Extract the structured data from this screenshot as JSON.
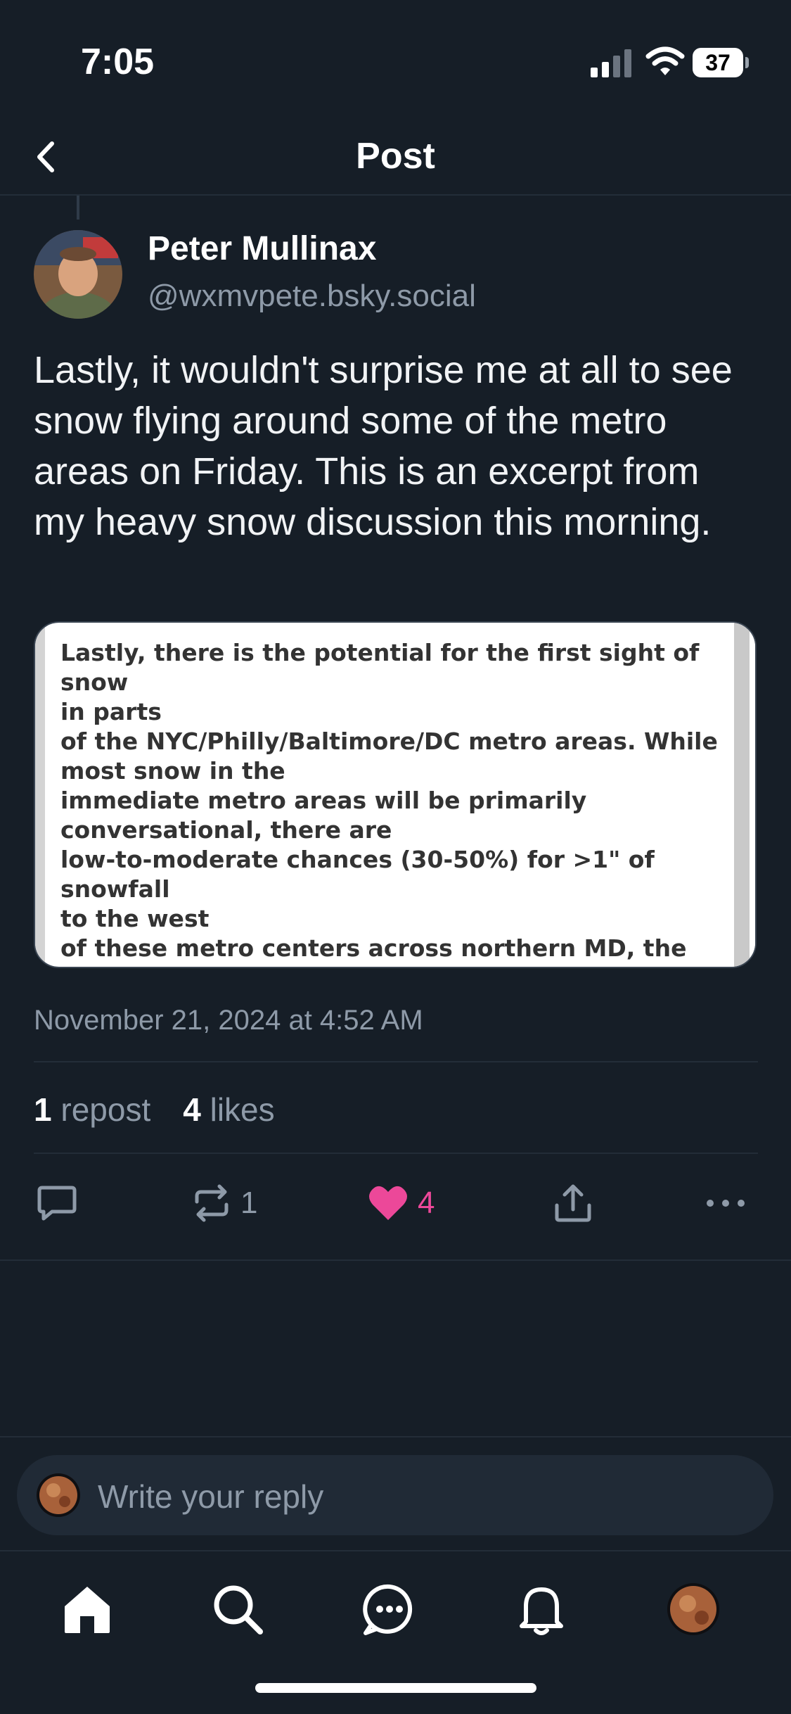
{
  "status_bar": {
    "time": "7:05",
    "battery": "37"
  },
  "header": {
    "title": "Post"
  },
  "post": {
    "author_name": "Peter Mullinax",
    "author_handle": "@wxmvpete.bsky.social",
    "text": "Lastly, it wouldn't surprise me at all to see snow flying around some of the metro areas on Friday. This is an excerpt from my heavy snow discussion this morning.",
    "embed_text": "Lastly, there is the potential for the first sight of snow\nin parts\nof the NYC/Philly/Baltimore/DC metro areas. While\nmost snow in the\nimmediate metro areas will be primarily\nconversational, there are\nlow-to-moderate chances (30-50%) for >1\" of snowfall\nto the west\nof these metro centers across northern MD, the Lower\nSusquehanna\nValley, and into northern NJ.",
    "timestamp": "November 21, 2024 at 4:52 AM",
    "stats": {
      "reposts_count": "1",
      "reposts_label": "repost",
      "likes_count": "4",
      "likes_label": "likes"
    },
    "actions": {
      "reply_icon": "reply-icon",
      "repost_count": "1",
      "like_count": "4",
      "share_icon": "share-icon",
      "more_icon": "more-icon"
    }
  },
  "reply": {
    "placeholder": "Write your reply"
  },
  "tabbar": {
    "items": [
      "home-icon",
      "search-icon",
      "chat-icon",
      "notifications-icon",
      "profile-avatar"
    ]
  },
  "colors": {
    "background": "#161e27",
    "accent_like": "#ec4899",
    "muted": "#8e9aa8"
  }
}
